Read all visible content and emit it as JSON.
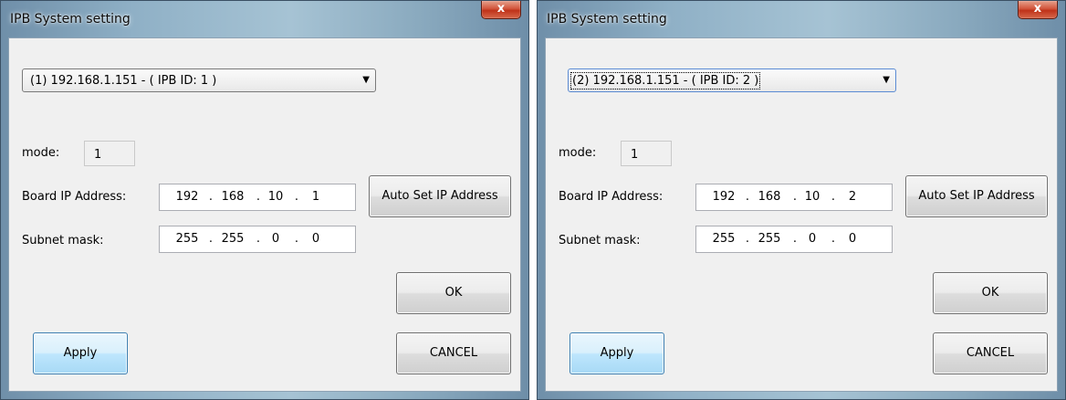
{
  "dialogs": [
    {
      "title": "IPB System setting",
      "close_glyph": "x",
      "device_select": {
        "value": "(1) 192.168.1.151 - ( IPB ID: 1 )",
        "arrow": "▼"
      },
      "mode_label": "mode:",
      "mode_value": "1",
      "board_ip_label": "Board IP Address:",
      "board_ip": [
        "192",
        "168",
        "10",
        "1"
      ],
      "subnet_label": "Subnet mask:",
      "subnet": [
        "255",
        "255",
        "0",
        "0"
      ],
      "auto_set_label": "Auto Set IP Address",
      "ok_label": "OK",
      "apply_label": "Apply",
      "cancel_label": "CANCEL"
    },
    {
      "title": "IPB System setting",
      "close_glyph": "x",
      "device_select": {
        "value": "(2) 192.168.1.151 - ( IPB ID: 2 )",
        "arrow": "▼"
      },
      "mode_label": "mode:",
      "mode_value": "1",
      "board_ip_label": "Board IP Address:",
      "board_ip": [
        "192",
        "168",
        "10",
        "2"
      ],
      "subnet_label": "Subnet mask:",
      "subnet": [
        "255",
        "255",
        "0",
        "0"
      ],
      "auto_set_label": "Auto Set IP Address",
      "ok_label": "OK",
      "apply_label": "Apply",
      "cancel_label": "CANCEL"
    }
  ],
  "ip_separator": "."
}
